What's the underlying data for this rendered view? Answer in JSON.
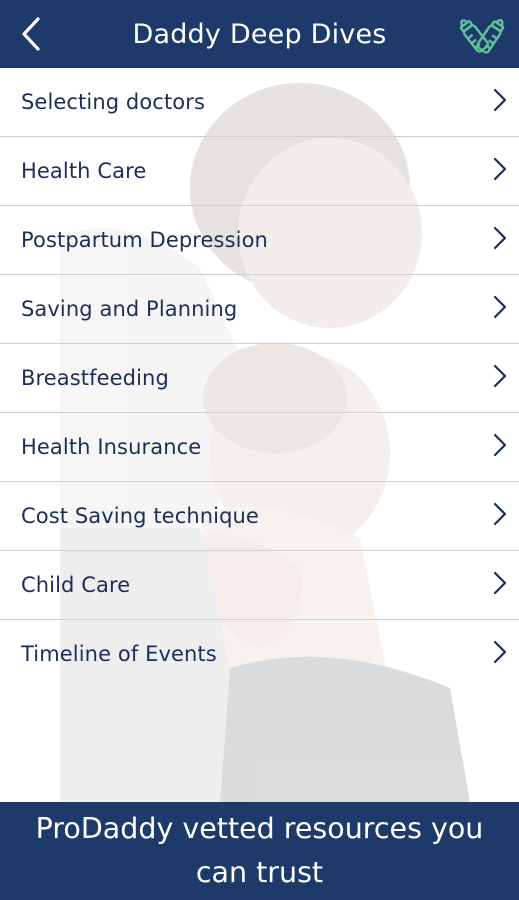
{
  "header": {
    "title": "Daddy Deep Dives",
    "back_icon": "chevron-left-icon",
    "action_icon": "baby-bottles-icon"
  },
  "menu": {
    "items": [
      {
        "label": "Selecting doctors"
      },
      {
        "label": "Health Care"
      },
      {
        "label": "Postpartum Depression"
      },
      {
        "label": "Saving and Planning"
      },
      {
        "label": "Breastfeeding"
      },
      {
        "label": "Health Insurance"
      },
      {
        "label": "Cost Saving technique"
      },
      {
        "label": "Child Care"
      },
      {
        "label": "Timeline of Events"
      }
    ],
    "chevron_icon": "chevron-right-icon"
  },
  "footer": {
    "tagline": "ProDaddy vetted resources you can trust"
  },
  "colors": {
    "primary": "#1d3a6b",
    "text": "#1a2e57",
    "accent_icon": "#5ec29a",
    "divider": "#d0d0d0"
  }
}
